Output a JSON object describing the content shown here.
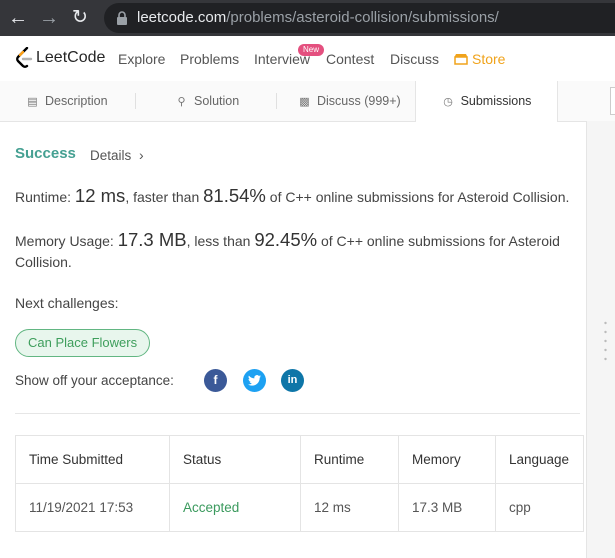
{
  "browser": {
    "url_host": "leetcode.com",
    "url_path": "/problems/asteroid-collision/submissions/"
  },
  "nav": {
    "logo_text": "LeetCode",
    "items": [
      "Explore",
      "Problems",
      "Interview",
      "Contest",
      "Discuss"
    ],
    "new_badge": "New",
    "store": "Store"
  },
  "tabs": [
    "Description",
    "Solution",
    "Discuss (999+)",
    "Submissions"
  ],
  "result": {
    "status": "Success",
    "details": "Details",
    "runtime_label": "Runtime:",
    "runtime_value": "12 ms",
    "runtime_mid": ", faster than",
    "runtime_pct": "81.54%",
    "runtime_tail": "of C++ online submissions for Asteroid Collision.",
    "memory_label": "Memory Usage:",
    "memory_value": "17.3 MB",
    "memory_mid": ", less than",
    "memory_pct": "92.45%",
    "memory_tail": "of C++ online submissions for Asteroid",
    "memory_tail2": "Collision.",
    "next_label": "Next challenges:",
    "next_challenge": "Can Place Flowers",
    "share_label": "Show off your acceptance:"
  },
  "table": {
    "headers": [
      "Time Submitted",
      "Status",
      "Runtime",
      "Memory",
      "Language"
    ],
    "rows": [
      [
        "11/19/2021 17:53",
        "Accepted",
        "12 ms",
        "17.3 MB",
        "cpp"
      ]
    ]
  },
  "colors": {
    "success": "#45a092",
    "accepted": "#3b9a5e",
    "facebook": "#3b5998",
    "twitter": "#1da1f2",
    "linkedin": "#0e76a8"
  }
}
